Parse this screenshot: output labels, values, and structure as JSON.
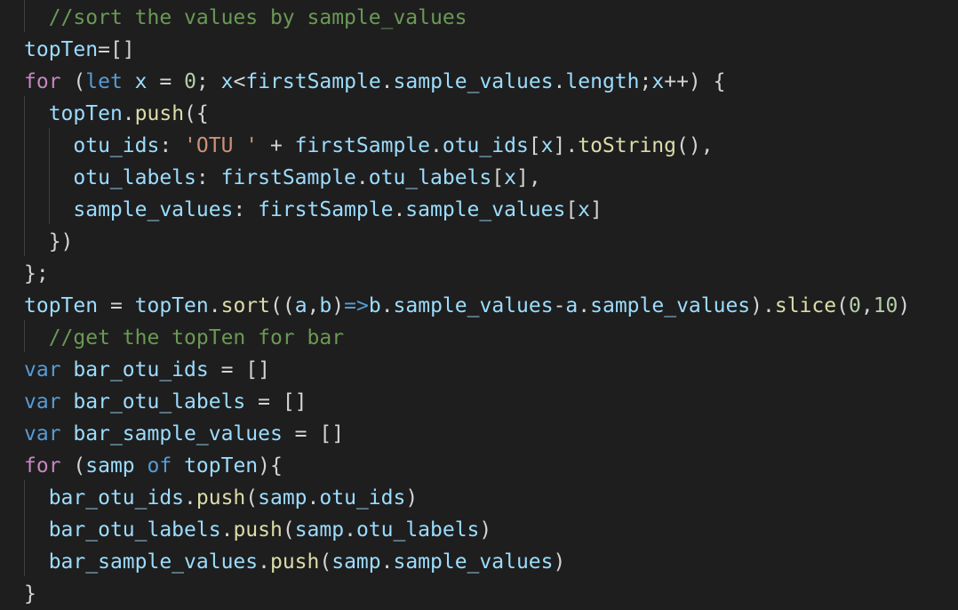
{
  "colors": {
    "background": "#1e1e1e",
    "comment": "#6a9955",
    "keyword": "#c586c0",
    "storage": "#569cd6",
    "variable": "#9cdcfe",
    "function": "#dcdcaa",
    "string": "#ce9178",
    "number": "#b5cea8",
    "punctuation": "#d4d4d4",
    "indent_guide": "#404040"
  },
  "code": {
    "lines": [
      [
        {
          "t": "  ",
          "k": "punct"
        },
        {
          "t": "//sort the values by sample_values",
          "k": "comment"
        }
      ],
      [
        {
          "t": "topTen",
          "k": "var"
        },
        {
          "t": "=[]",
          "k": "punct"
        }
      ],
      [
        {
          "t": "for",
          "k": "keyword"
        },
        {
          "t": " (",
          "k": "punct"
        },
        {
          "t": "let",
          "k": "storage"
        },
        {
          "t": " ",
          "k": "punct"
        },
        {
          "t": "x",
          "k": "var"
        },
        {
          "t": " = ",
          "k": "punct"
        },
        {
          "t": "0",
          "k": "number"
        },
        {
          "t": "; ",
          "k": "punct"
        },
        {
          "t": "x",
          "k": "var"
        },
        {
          "t": "<",
          "k": "punct"
        },
        {
          "t": "firstSample",
          "k": "var"
        },
        {
          "t": ".",
          "k": "punct"
        },
        {
          "t": "sample_values",
          "k": "var"
        },
        {
          "t": ".",
          "k": "punct"
        },
        {
          "t": "length",
          "k": "var"
        },
        {
          "t": ";",
          "k": "punct"
        },
        {
          "t": "x",
          "k": "var"
        },
        {
          "t": "++) {",
          "k": "punct"
        }
      ],
      [
        {
          "t": "  ",
          "k": "punct"
        },
        {
          "t": "topTen",
          "k": "var"
        },
        {
          "t": ".",
          "k": "punct"
        },
        {
          "t": "push",
          "k": "fn"
        },
        {
          "t": "({",
          "k": "punct"
        }
      ],
      [
        {
          "t": "    ",
          "k": "punct"
        },
        {
          "t": "otu_ids",
          "k": "var"
        },
        {
          "t": ": ",
          "k": "punct"
        },
        {
          "t": "'OTU '",
          "k": "string"
        },
        {
          "t": " + ",
          "k": "punct"
        },
        {
          "t": "firstSample",
          "k": "var"
        },
        {
          "t": ".",
          "k": "punct"
        },
        {
          "t": "otu_ids",
          "k": "var"
        },
        {
          "t": "[",
          "k": "punct"
        },
        {
          "t": "x",
          "k": "var"
        },
        {
          "t": "].",
          "k": "punct"
        },
        {
          "t": "toString",
          "k": "fn"
        },
        {
          "t": "(),",
          "k": "punct"
        }
      ],
      [
        {
          "t": "    ",
          "k": "punct"
        },
        {
          "t": "otu_labels",
          "k": "var"
        },
        {
          "t": ": ",
          "k": "punct"
        },
        {
          "t": "firstSample",
          "k": "var"
        },
        {
          "t": ".",
          "k": "punct"
        },
        {
          "t": "otu_labels",
          "k": "var"
        },
        {
          "t": "[",
          "k": "punct"
        },
        {
          "t": "x",
          "k": "var"
        },
        {
          "t": "],",
          "k": "punct"
        }
      ],
      [
        {
          "t": "    ",
          "k": "punct"
        },
        {
          "t": "sample_values",
          "k": "var"
        },
        {
          "t": ": ",
          "k": "punct"
        },
        {
          "t": "firstSample",
          "k": "var"
        },
        {
          "t": ".",
          "k": "punct"
        },
        {
          "t": "sample_values",
          "k": "var"
        },
        {
          "t": "[",
          "k": "punct"
        },
        {
          "t": "x",
          "k": "var"
        },
        {
          "t": "]",
          "k": "punct"
        }
      ],
      [
        {
          "t": "  })",
          "k": "punct"
        }
      ],
      [
        {
          "t": "};",
          "k": "punct"
        }
      ],
      [
        {
          "t": "topTen",
          "k": "var"
        },
        {
          "t": " = ",
          "k": "punct"
        },
        {
          "t": "topTen",
          "k": "var"
        },
        {
          "t": ".",
          "k": "punct"
        },
        {
          "t": "sort",
          "k": "fn"
        },
        {
          "t": "((",
          "k": "punct"
        },
        {
          "t": "a",
          "k": "var"
        },
        {
          "t": ",",
          "k": "punct"
        },
        {
          "t": "b",
          "k": "var"
        },
        {
          "t": ")",
          "k": "punct"
        },
        {
          "t": "=>",
          "k": "storage"
        },
        {
          "t": "b",
          "k": "var"
        },
        {
          "t": ".",
          "k": "punct"
        },
        {
          "t": "sample_values",
          "k": "var"
        },
        {
          "t": "-",
          "k": "punct"
        },
        {
          "t": "a",
          "k": "var"
        },
        {
          "t": ".",
          "k": "punct"
        },
        {
          "t": "sample_values",
          "k": "var"
        },
        {
          "t": ").",
          "k": "punct"
        },
        {
          "t": "slice",
          "k": "fn"
        },
        {
          "t": "(",
          "k": "punct"
        },
        {
          "t": "0",
          "k": "number"
        },
        {
          "t": ",",
          "k": "punct"
        },
        {
          "t": "10",
          "k": "number"
        },
        {
          "t": ")",
          "k": "punct"
        }
      ],
      [
        {
          "t": "  ",
          "k": "punct"
        },
        {
          "t": "//get the topTen for bar",
          "k": "comment"
        }
      ],
      [
        {
          "t": "var",
          "k": "storage"
        },
        {
          "t": " ",
          "k": "punct"
        },
        {
          "t": "bar_otu_ids",
          "k": "var"
        },
        {
          "t": " = []",
          "k": "punct"
        }
      ],
      [
        {
          "t": "var",
          "k": "storage"
        },
        {
          "t": " ",
          "k": "punct"
        },
        {
          "t": "bar_otu_labels",
          "k": "var"
        },
        {
          "t": " = []",
          "k": "punct"
        }
      ],
      [
        {
          "t": "var",
          "k": "storage"
        },
        {
          "t": " ",
          "k": "punct"
        },
        {
          "t": "bar_sample_values",
          "k": "var"
        },
        {
          "t": " = []",
          "k": "punct"
        }
      ],
      [
        {
          "t": "for",
          "k": "keyword"
        },
        {
          "t": " (",
          "k": "punct"
        },
        {
          "t": "samp",
          "k": "var"
        },
        {
          "t": " ",
          "k": "punct"
        },
        {
          "t": "of",
          "k": "storage"
        },
        {
          "t": " ",
          "k": "punct"
        },
        {
          "t": "topTen",
          "k": "var"
        },
        {
          "t": "){",
          "k": "punct"
        }
      ],
      [
        {
          "t": "  ",
          "k": "punct"
        },
        {
          "t": "bar_otu_ids",
          "k": "var"
        },
        {
          "t": ".",
          "k": "punct"
        },
        {
          "t": "push",
          "k": "fn"
        },
        {
          "t": "(",
          "k": "punct"
        },
        {
          "t": "samp",
          "k": "var"
        },
        {
          "t": ".",
          "k": "punct"
        },
        {
          "t": "otu_ids",
          "k": "var"
        },
        {
          "t": ")",
          "k": "punct"
        }
      ],
      [
        {
          "t": "  ",
          "k": "punct"
        },
        {
          "t": "bar_otu_labels",
          "k": "var"
        },
        {
          "t": ".",
          "k": "punct"
        },
        {
          "t": "push",
          "k": "fn"
        },
        {
          "t": "(",
          "k": "punct"
        },
        {
          "t": "samp",
          "k": "var"
        },
        {
          "t": ".",
          "k": "punct"
        },
        {
          "t": "otu_labels",
          "k": "var"
        },
        {
          "t": ")",
          "k": "punct"
        }
      ],
      [
        {
          "t": "  ",
          "k": "punct"
        },
        {
          "t": "bar_sample_values",
          "k": "var"
        },
        {
          "t": ".",
          "k": "punct"
        },
        {
          "t": "push",
          "k": "fn"
        },
        {
          "t": "(",
          "k": "punct"
        },
        {
          "t": "samp",
          "k": "var"
        },
        {
          "t": ".",
          "k": "punct"
        },
        {
          "t": "sample_values",
          "k": "var"
        },
        {
          "t": ")",
          "k": "punct"
        }
      ],
      [
        {
          "t": "}",
          "k": "punct"
        }
      ]
    ]
  }
}
